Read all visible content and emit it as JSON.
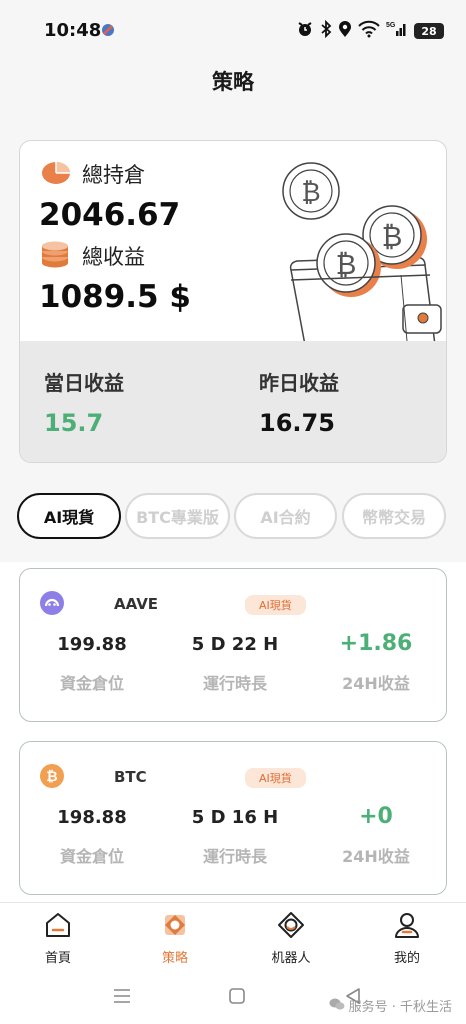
{
  "status": {
    "time": "10:48",
    "battery": "28",
    "network": "5G"
  },
  "header": {
    "title": "策略"
  },
  "summary": {
    "holdings_label": "總持倉",
    "holdings_value": "2046.67",
    "profit_label": "總收益",
    "profit_value": "1089.5 $",
    "today_label": "當日收益",
    "today_value": "15.7",
    "yesterday_label": "昨日收益",
    "yesterday_value": "16.75"
  },
  "tabs": [
    {
      "label": "AI現貨",
      "active": true
    },
    {
      "label": "BTC專業版",
      "active": false
    },
    {
      "label": "AI合約",
      "active": false
    },
    {
      "label": "幣幣交易",
      "active": false
    }
  ],
  "strategies": [
    {
      "coin": "AAVE",
      "badge": "AI現貨",
      "capital_value": "199.88",
      "capital_label": "資金倉位",
      "runtime_value": "5 D 22 H",
      "runtime_label": "運行時長",
      "profit_value": "+1.86",
      "profit_label": "24H收益"
    },
    {
      "coin": "BTC",
      "badge": "AI現貨",
      "capital_value": "198.88",
      "capital_label": "資金倉位",
      "runtime_value": "5 D 16 H",
      "runtime_label": "運行時長",
      "profit_value": "+0",
      "profit_label": "24H收益"
    }
  ],
  "nav": [
    {
      "label": "首頁",
      "icon": "home-icon"
    },
    {
      "label": "策略",
      "icon": "strategy-icon",
      "active": true
    },
    {
      "label": "机器人",
      "icon": "robot-icon"
    },
    {
      "label": "我的",
      "icon": "profile-icon"
    }
  ],
  "watermark": "服务号 · 千秋生活",
  "colors": {
    "accent": "#e07b3c",
    "positive": "#4caf76",
    "badge_bg": "#fbe6d8"
  }
}
